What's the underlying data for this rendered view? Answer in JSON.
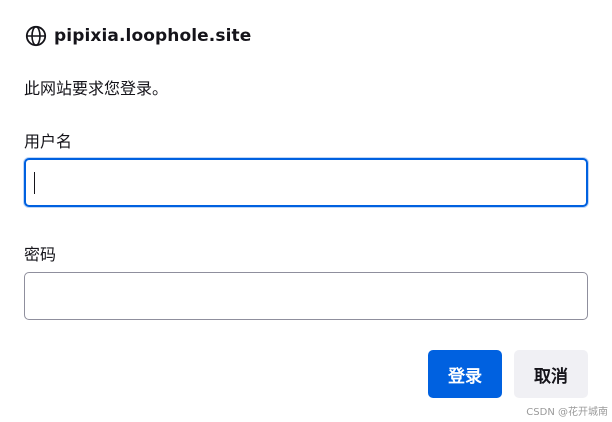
{
  "dialog": {
    "origin": "pipixia.loophole.site",
    "origin_icon": "globe-icon",
    "message": "此网站要求您登录。"
  },
  "form": {
    "username_label": "用户名",
    "username_value": "",
    "password_label": "密码",
    "password_value": ""
  },
  "buttons": {
    "login_label": "登录",
    "cancel_label": "取消"
  },
  "colors": {
    "accent": "#0061e0",
    "secondary_button_bg": "#f0f0f4",
    "border": "#8f8f9d",
    "text": "#15141a"
  },
  "watermark": "CSDN @花开城南"
}
